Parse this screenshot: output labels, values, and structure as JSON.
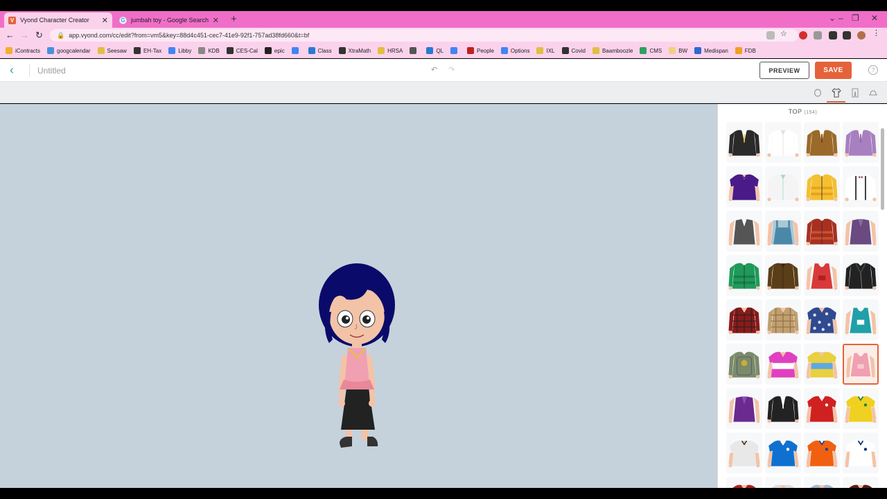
{
  "browser": {
    "tabs": [
      {
        "label": "Vyond Character Creator",
        "active": true
      },
      {
        "label": "jumbah toy - Google Search",
        "active": false
      }
    ],
    "url": "app.vyond.com/cc/edit?from=vm5&key=88d4c451-cec7-41e9-92f1-757ad38fd660&t=bf",
    "bookmarks": [
      "iContracts",
      "googcalendar",
      "Seesaw",
      "EH-Tax",
      "Libby",
      "KDB",
      "CES-Cal",
      "epic",
      "",
      "Class",
      "XtraMath",
      "HRSA",
      "",
      "QL",
      "",
      "People",
      "Options",
      "IXL",
      "Covid",
      "Baamboozle",
      "CMS",
      "BW",
      "Medispan",
      "FDB"
    ]
  },
  "header": {
    "title": "Untitled",
    "preview_label": "PREVIEW",
    "save_label": "SAVE",
    "help": "?"
  },
  "panel": {
    "title": "TOP",
    "count": "(154)"
  },
  "colors": {
    "accent": "#e5623a",
    "teal": "#2fa7a0",
    "stage": "#c5d2dc",
    "tabbar": "#f06ec8"
  },
  "items": [
    {
      "color": "#2a2a2a",
      "accent": "#e8c83a",
      "style": "suit"
    },
    {
      "color": "#ffffff",
      "accent": "#e0e0e0",
      "style": "shirt"
    },
    {
      "color": "#9b6a2a",
      "accent": "#6a3a10",
      "style": "suit"
    },
    {
      "color": "#a880c0",
      "accent": "#8860a0",
      "style": "suit"
    },
    {
      "color": "#4a1a88",
      "accent": "#3a1070",
      "style": "polo"
    },
    {
      "color": "#f4f4f4",
      "accent": "#a8d8d0",
      "style": "shirt"
    },
    {
      "color": "#f4c030",
      "accent": "#e8a020",
      "style": "jacket"
    },
    {
      "color": "#ffffff",
      "accent": "#222222",
      "style": "suspenders"
    },
    {
      "color": "#555555",
      "accent": "#ffffff",
      "style": "vest"
    },
    {
      "color": "#4a88a8",
      "accent": "#a8c8d8",
      "style": "overalls"
    },
    {
      "color": "#a83020",
      "accent": "#c85030",
      "style": "jacket"
    },
    {
      "color": "#6a4a80",
      "accent": "#8868a0",
      "style": "vest"
    },
    {
      "color": "#1f9a5a",
      "accent": "#178048",
      "style": "jacket"
    },
    {
      "color": "#5a3e18",
      "accent": "#3a2810",
      "style": "shirt"
    },
    {
      "color": "#d83a3a",
      "accent": "#b02020",
      "style": "tank"
    },
    {
      "color": "#222222",
      "accent": "#444444",
      "style": "leather"
    },
    {
      "color": "#8a1a1a",
      "accent": "#222222",
      "style": "plaid"
    },
    {
      "color": "#c0a070",
      "accent": "#8a6a40",
      "style": "plaid"
    },
    {
      "color": "#304a90",
      "accent": "#e0e0f0",
      "style": "hawaiian"
    },
    {
      "color": "#20a0a8",
      "accent": "#ffffff",
      "style": "tank"
    },
    {
      "color": "#7a8a6a",
      "accent": "#c8b030",
      "style": "backpack"
    },
    {
      "color": "#e040c0",
      "accent": "#ffffff",
      "style": "tee"
    },
    {
      "color": "#e8d040",
      "accent": "#60a8e0",
      "style": "tee"
    },
    {
      "color": "#f0a0b0",
      "accent": "#f8c8d0",
      "style": "tank"
    },
    {
      "color": "#6a2a90",
      "accent": "#8a4ab0",
      "style": "vest"
    },
    {
      "color": "#222222",
      "accent": "#ffffff",
      "style": "suit"
    },
    {
      "color": "#d02020",
      "accent": "#ffffff",
      "style": "jersey"
    },
    {
      "color": "#f0d020",
      "accent": "#208040",
      "style": "jersey"
    },
    {
      "color": "#e8e8e8",
      "accent": "#222222",
      "style": "polo"
    },
    {
      "color": "#1070d0",
      "accent": "#ffffff",
      "style": "jersey"
    },
    {
      "color": "#f06010",
      "accent": "#2040a0",
      "style": "jersey"
    },
    {
      "color": "#ffffff",
      "accent": "#103070",
      "style": "jersey"
    },
    {
      "color": "#b02020",
      "accent": "#222222",
      "style": "tee"
    },
    {
      "color": "#dddddd",
      "accent": "#aaaaaa",
      "style": "tee"
    },
    {
      "color": "#a0b8d0",
      "accent": "#ffffff",
      "style": "tee"
    },
    {
      "color": "#5a2010",
      "accent": "#222222",
      "style": "tee"
    }
  ],
  "selected_index": 23
}
